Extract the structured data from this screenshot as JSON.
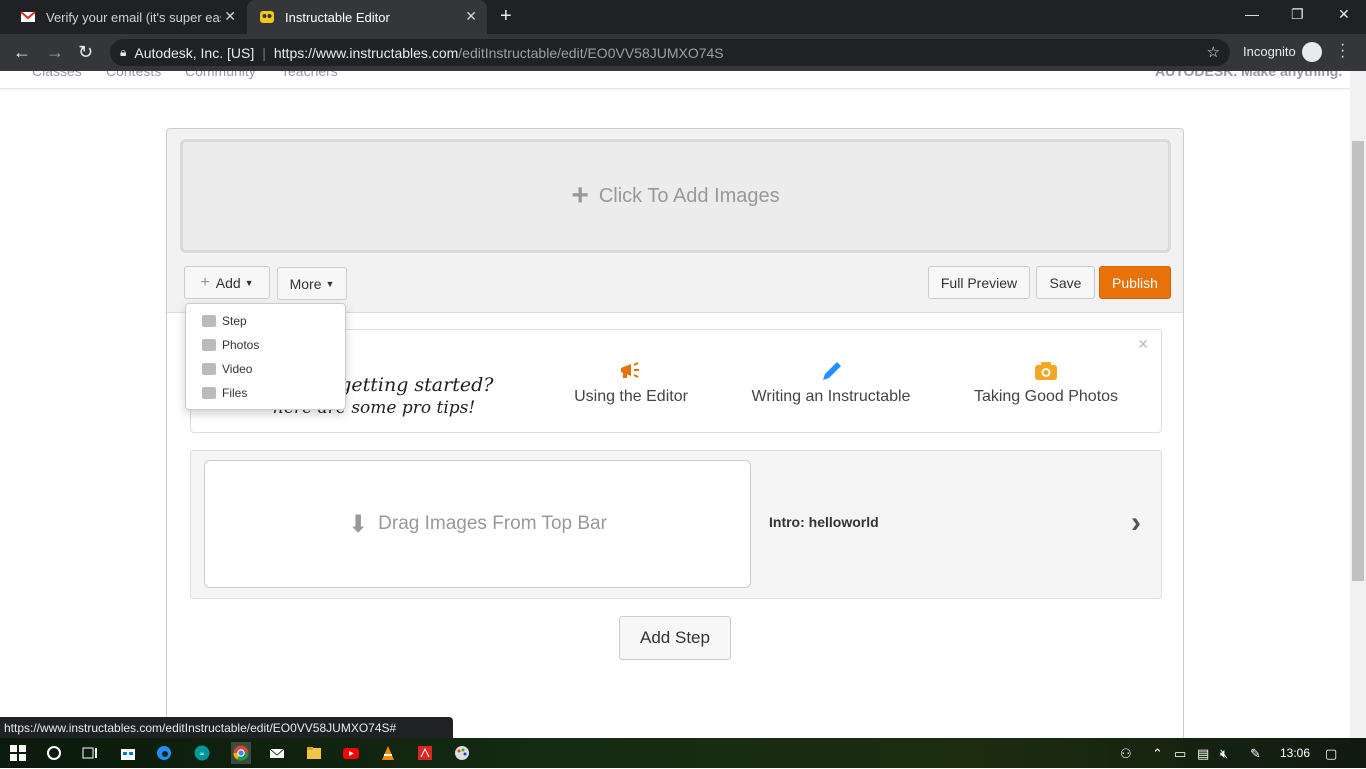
{
  "browser": {
    "tabs": [
      {
        "title": "Verify your email (it's super easy)",
        "active": false
      },
      {
        "title": "Instructable Editor",
        "active": true
      }
    ],
    "address": {
      "org": "Autodesk, Inc. [US]",
      "host": "https://www.instructables.com",
      "path": "/editInstructable/edit/EO0VV58JUMXO74S"
    },
    "profile_label": "Incognito"
  },
  "site_nav": {
    "items": [
      "Classes",
      "Contests",
      "Community",
      "Teachers"
    ],
    "brand": "AUTODESK. Make anything."
  },
  "editor": {
    "add_images": "Click To Add Images",
    "toolbar": {
      "add_label": "Add",
      "more_label": "More",
      "full_preview_label": "Full Preview",
      "save_label": "Save",
      "publish_label": "Publish"
    },
    "add_menu": [
      "Step",
      "Photos",
      "Video",
      "Files"
    ],
    "tips": {
      "line1": "p getting started?",
      "line2": "here are some pro tips!",
      "items": [
        "Using the Editor",
        "Writing an Instructable",
        "Taking Good Photos"
      ]
    },
    "step": {
      "dropzone": "Drag Images From Top Bar",
      "title": "Intro: helloworld"
    },
    "add_step_label": "Add Step"
  },
  "status_url": "https://www.instructables.com/editInstructable/edit/EO0VV58JUMXO74S#",
  "taskbar": {
    "clock": "13:06"
  },
  "colors": {
    "publish": "#e8710a",
    "tip_icon": "#e8710a",
    "pen_icon": "#1e90ff",
    "camera_icon": "#f5a623"
  }
}
